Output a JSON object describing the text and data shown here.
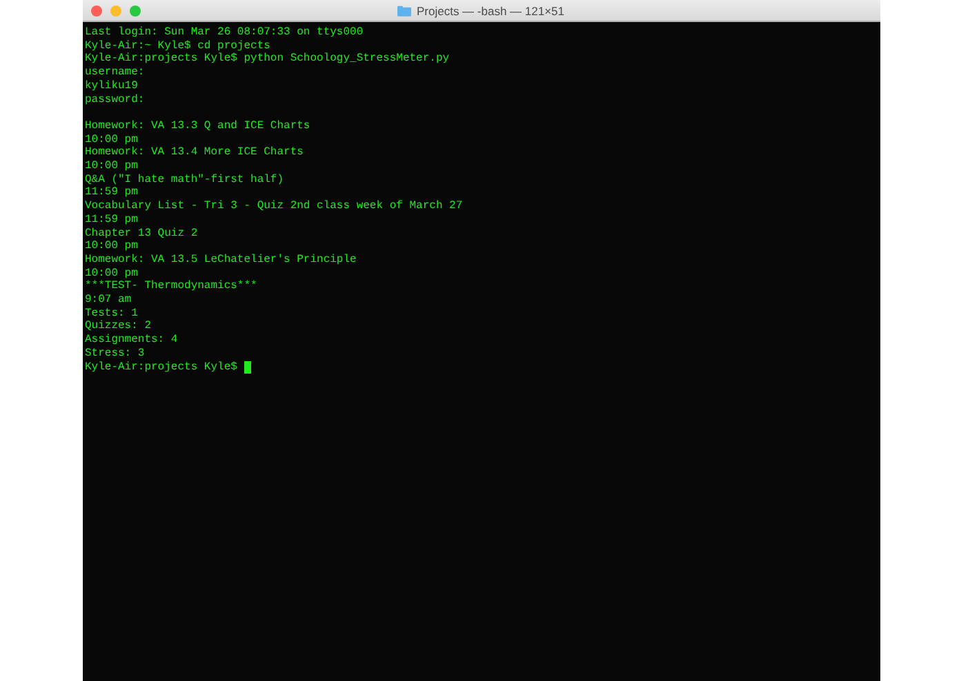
{
  "window": {
    "title": "Projects — -bash — 121×51"
  },
  "terminal": {
    "blocks": [
      [
        "Last login: Sun Mar 26 08:07:33 on ttys000",
        "Kyle-Air:~ Kyle$ cd projects",
        "Kyle-Air:projects Kyle$ python Schoology_StressMeter.py",
        "username:",
        "kyliku19",
        "password:"
      ],
      [
        "Homework: VA 13.3 Q and ICE Charts",
        "10:00 pm",
        "Homework: VA 13.4 More ICE Charts",
        "10:00 pm",
        "Q&A (\"I hate math\"-first half)",
        "11:59 pm",
        "Vocabulary List - Tri 3 - Quiz 2nd class week of March 27",
        "11:59 pm",
        "Chapter 13 Quiz 2",
        "10:00 pm",
        "Homework: VA 13.5 LeChatelier's Principle",
        "10:00 pm",
        "***TEST- Thermodynamics***",
        "9:07 am",
        "Tests: 1",
        "Quizzes: 2",
        "Assignments: 4",
        "Stress: 3"
      ]
    ],
    "prompt": "Kyle-Air:projects Kyle$",
    "cursor": true
  }
}
